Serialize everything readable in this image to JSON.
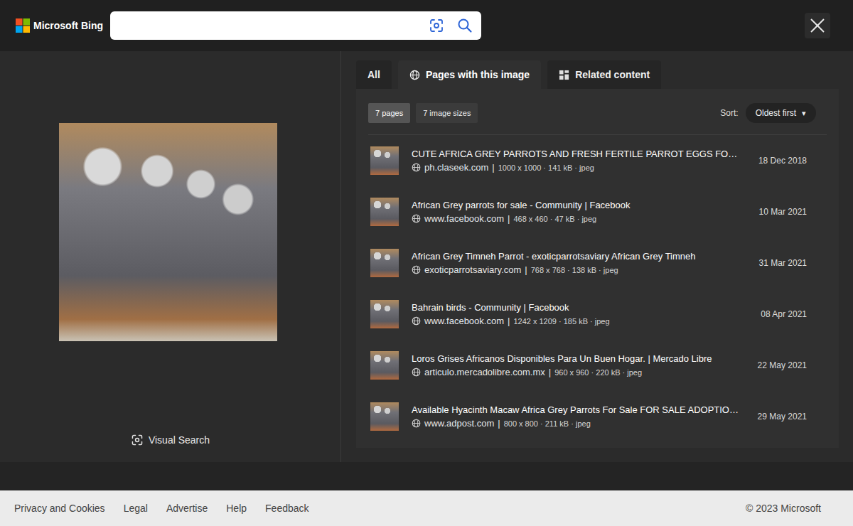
{
  "header": {
    "brand": "Microsoft Bing",
    "search": {
      "value": ""
    }
  },
  "preview": {
    "visual_search": "Visual Search"
  },
  "tabs": [
    {
      "label": "All",
      "kind": "plain",
      "selected": false
    },
    {
      "label": "Pages with this image",
      "kind": "pages",
      "selected": true
    },
    {
      "label": "Related content",
      "kind": "related",
      "selected": false
    }
  ],
  "filters": [
    {
      "label": "7 pages",
      "selected": true
    },
    {
      "label": "7 image sizes",
      "selected": false
    }
  ],
  "sort": {
    "label": "Sort:",
    "value": "Oldest first",
    "arrow": "▾"
  },
  "separator": "|",
  "results": [
    {
      "title": "CUTE AFRICA GREY PARROTS AND FRESH FERTILE PARROT EGGS FO…",
      "site": "ph.claseek.com",
      "details": "1000 x 1000 · 141 kB · jpeg",
      "date": "18 Dec 2018"
    },
    {
      "title": "African Grey parrots for sale - Community | Facebook",
      "site": "www.facebook.com",
      "details": "468 x 460 · 47 kB · jpeg",
      "date": "10 Mar 2021"
    },
    {
      "title": "African Grey Timneh Parrot - exoticparrotsaviary African Grey Timneh",
      "site": "exoticparrotsaviary.com",
      "details": "768 x 768 · 138 kB · jpeg",
      "date": "31 Mar 2021"
    },
    {
      "title": "Bahrain birds - Community | Facebook",
      "site": "www.facebook.com",
      "details": "1242 x 1209 · 185 kB · jpeg",
      "date": "08 Apr 2021"
    },
    {
      "title": "Loros Grises Africanos Disponibles Para Un Buen Hogar. | Mercado Libre",
      "site": "articulo.mercadolibre.com.mx",
      "details": "960 x 960 · 220 kB · jpeg",
      "date": "22 May 2021"
    },
    {
      "title": "Available Hyacinth Macaw Africa Grey Parrots For Sale FOR SALE ADOPTIO…",
      "site": "www.adpost.com",
      "details": "800 x 800 · 211 kB · jpeg",
      "date": "29 May 2021"
    }
  ],
  "footer": {
    "links": [
      "Privacy and Cookies",
      "Legal",
      "Advertise",
      "Help",
      "Feedback"
    ],
    "copyright": "© 2023 Microsoft"
  }
}
